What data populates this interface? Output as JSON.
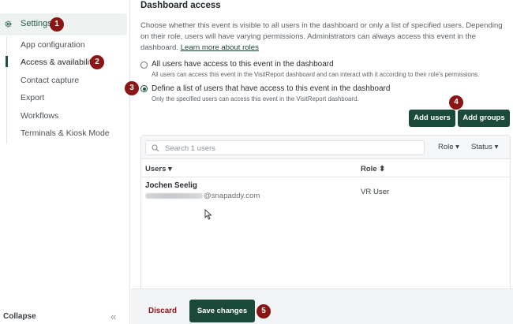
{
  "sidebar": {
    "settings_label": "Settings",
    "items": [
      {
        "label": "App configuration"
      },
      {
        "label": "Access & availability"
      },
      {
        "label": "Contact capture"
      },
      {
        "label": "Export"
      },
      {
        "label": "Workflows"
      },
      {
        "label": "Terminals & Kiosk Mode"
      }
    ],
    "active_index": 1,
    "collapse_label": "Collapse"
  },
  "badges": [
    "1",
    "2",
    "3",
    "4",
    "5"
  ],
  "main": {
    "title": "Dashboard access",
    "description": "Choose whether this event is visible to all users in the dashboard or only a list of specified users. Depending on their role, users will have varying permissions. Administrators can always access this event in the dashboard.",
    "learn_more": "Learn more about roles",
    "options": [
      {
        "title": "All users have access to this event in the dashboard",
        "subtitle": "All users can access this event in the VisitReport dashboard and can interact with it according to their role's permissions.",
        "selected": false
      },
      {
        "title": "Define a list of users that have access to this event in the dashboard",
        "subtitle": "Only the specified users can access this event in the VisitReport dashboard.",
        "selected": true
      }
    ],
    "add_users": "Add users",
    "add_groups": "Add groups"
  },
  "table": {
    "search_placeholder": "Search 1 users",
    "filters": [
      {
        "label": "Role ▾"
      },
      {
        "label": "Status ▾"
      }
    ],
    "columns": [
      {
        "label": "Users ▾"
      },
      {
        "label": "Role ⬍"
      }
    ],
    "rows": [
      {
        "name": "Jochen Seelig",
        "email_suffix": "@snapaddy.com",
        "role": "VR User"
      }
    ]
  },
  "footer": {
    "discard": "Discard",
    "save": "Save changes"
  },
  "colors": {
    "primary": "#1b4a3a",
    "badge": "#8b1414",
    "discard": "#8b1414"
  }
}
